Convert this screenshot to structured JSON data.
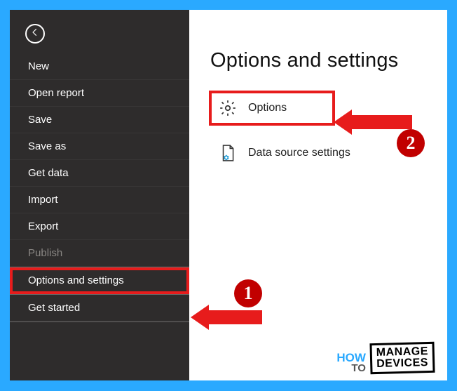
{
  "sidebar": {
    "items": [
      {
        "label": "New",
        "disabled": false
      },
      {
        "label": "Open report",
        "disabled": false
      },
      {
        "label": "Save",
        "disabled": false
      },
      {
        "label": "Save as",
        "disabled": false
      },
      {
        "label": "Get data",
        "disabled": false
      },
      {
        "label": "Import",
        "disabled": false
      },
      {
        "label": "Export",
        "disabled": false
      },
      {
        "label": "Publish",
        "disabled": true
      },
      {
        "label": "Options and settings",
        "disabled": false,
        "selected": true
      },
      {
        "label": "Get started",
        "disabled": false
      }
    ]
  },
  "page": {
    "title": "Options and settings",
    "options": [
      {
        "label": "Options",
        "icon": "gear",
        "highlighted": true
      },
      {
        "label": "Data source settings",
        "icon": "datasource",
        "highlighted": false
      }
    ]
  },
  "annotations": {
    "badge1": "1",
    "badge2": "2"
  },
  "watermark": {
    "how": "HOW",
    "to": "TO",
    "line1": "MANAGE",
    "line2": "DEVICES"
  },
  "colors": {
    "accent_frame": "#2aa9ff",
    "sidebar_bg": "#2e2c2c",
    "highlight": "#e71c1c",
    "badge": "#c10000"
  }
}
